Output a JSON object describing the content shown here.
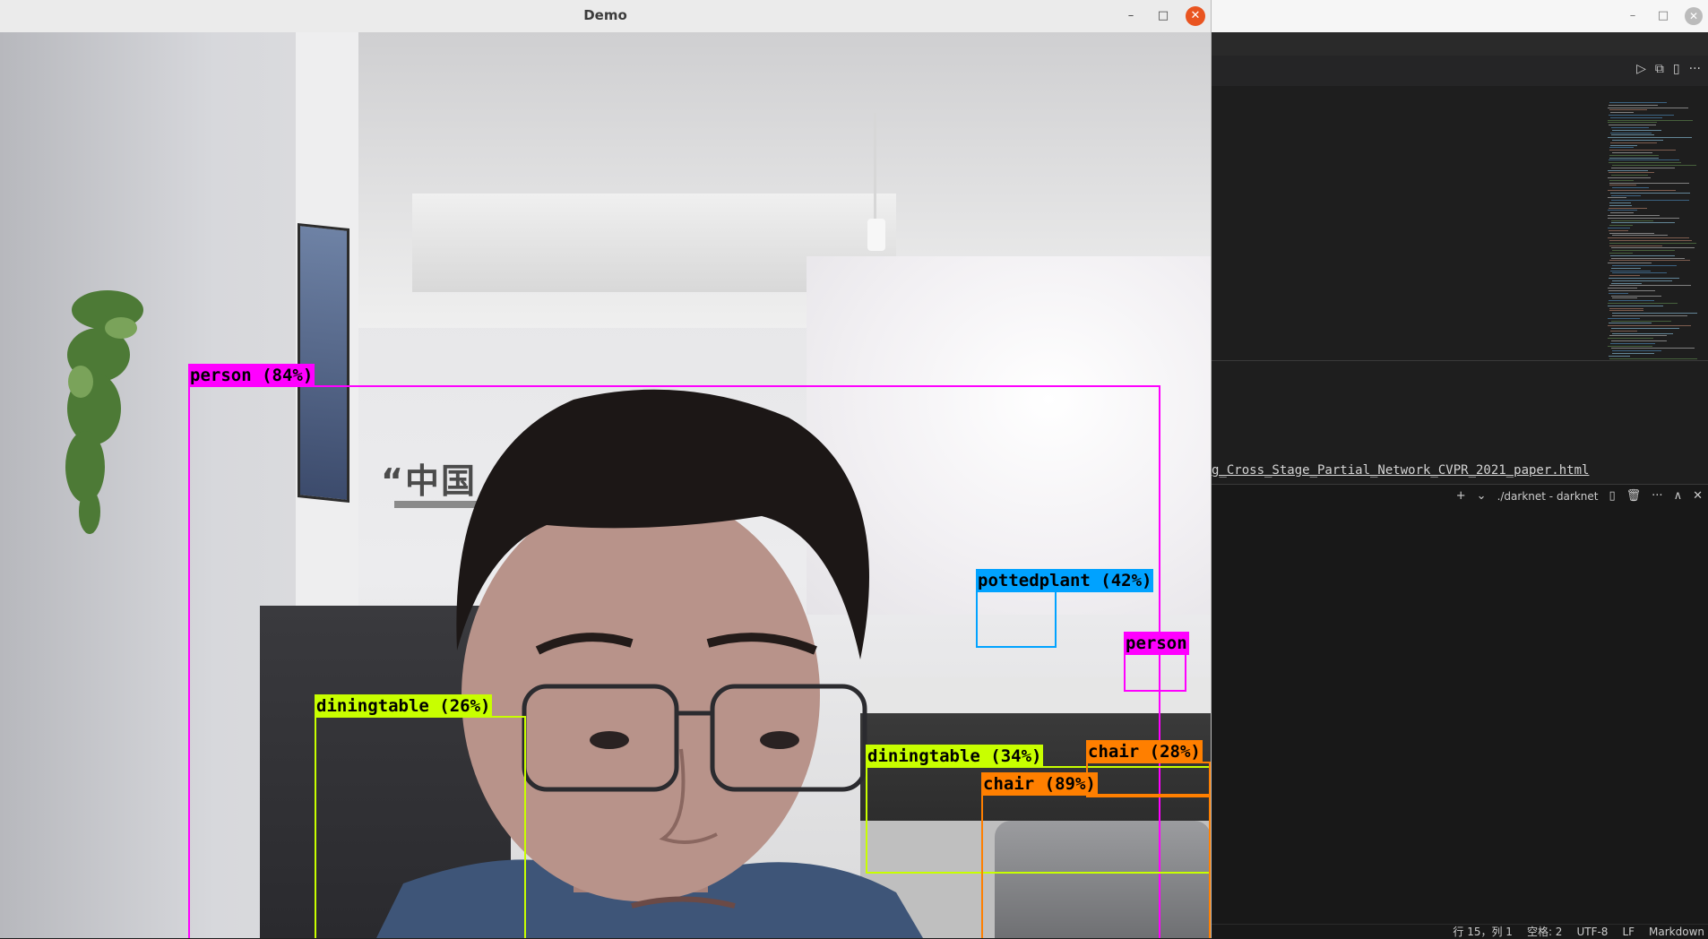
{
  "demo_window": {
    "title": "Demo",
    "controls": {
      "minimize": "–",
      "maximize": "□",
      "close": "✕"
    }
  },
  "scene": {
    "wall_text": "“中国"
  },
  "detections": [
    {
      "label": "person (84%)",
      "color": "#ff00ff"
    },
    {
      "label": "pottedplant (42%)",
      "color": "#00a2ff"
    },
    {
      "label": "person",
      "color": "#ff00ff"
    },
    {
      "label": "diningtable (26%)",
      "color": "#c8ff00"
    },
    {
      "label": "diningtable (34%)",
      "color": "#c8ff00"
    },
    {
      "label": "chair (28%)",
      "color": "#ff7f00"
    },
    {
      "label": "chair (89%)",
      "color": "#ff7f00"
    }
  ],
  "vscode": {
    "window_controls": {
      "minimize": "–",
      "maximize": "□",
      "close": "✕"
    },
    "editor_actions": {
      "run": "▷",
      "split_preview": "⧉",
      "split": "▯",
      "more": "···"
    },
    "link_text": "g_Cross_Stage_Partial_Network_CVPR_2021_paper.html",
    "terminal": {
      "name": "./darknet - darknet",
      "actions": {
        "add": "+",
        "dropdown": "⌄",
        "split": "▯",
        "trash": "🗑",
        "more": "···",
        "maximize": "∧",
        "close": "✕"
      }
    },
    "statusbar": {
      "position": "行 15，列 1",
      "indent": "空格: 2",
      "encoding": "UTF-8",
      "eol": "LF",
      "language": "Markdown"
    }
  },
  "colors": {
    "person": "#ff00ff",
    "pottedplant": "#00a2ff",
    "diningtable": "#c8ff00",
    "chair": "#ff7f00",
    "demo_close": "#e95420"
  }
}
